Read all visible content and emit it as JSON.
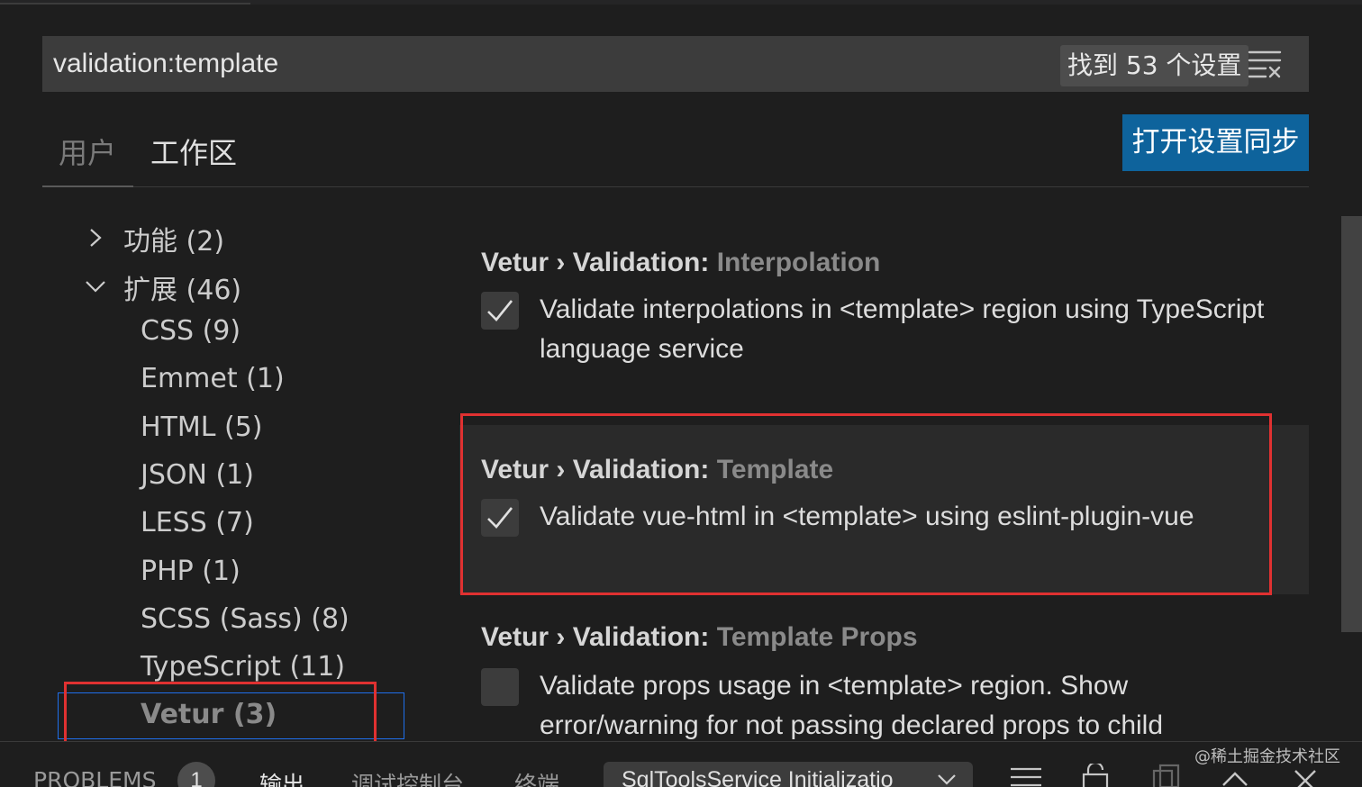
{
  "search": {
    "value": "validation:template",
    "result_count": "找到 53 个设置"
  },
  "tabs": {
    "user": "用户",
    "workspace": "工作区"
  },
  "sync_button": "打开设置同步",
  "toc": {
    "features": "功能 (2)",
    "extensions": "扩展 (46)",
    "items": [
      "CSS (9)",
      "Emmet (1)",
      "HTML (5)",
      "JSON (1)",
      "LESS (7)",
      "PHP (1)",
      "SCSS (Sass) (8)",
      "TypeScript (11)",
      "Vetur (3)"
    ]
  },
  "settings": [
    {
      "category": "Vetur › Validation: ",
      "key": "Interpolation",
      "checked": true,
      "description": "Validate interpolations in <template> region using TypeScript language service"
    },
    {
      "category": "Vetur › Validation: ",
      "key": "Template",
      "checked": true,
      "description": "Validate vue-html in <template> using eslint-plugin-vue"
    },
    {
      "category": "Vetur › Validation: ",
      "key": "Template Props",
      "checked": false,
      "description": "Validate props usage in <template> region. Show error/warning for not passing declared props to child"
    }
  ],
  "panel": {
    "problems": "PROBLEMS",
    "problems_count": "1",
    "output": "输出",
    "debug_console": "调试控制台",
    "terminal": "终端",
    "output_channel": "SqlToolsService Initializatio"
  },
  "watermark": "@稀土掘金技术社区",
  "colors": {
    "background": "#1e1e1e",
    "input": "#3c3c3c",
    "accent_button": "#0e639c",
    "highlight_border": "#e03131",
    "focus_border": "#1f6feb"
  }
}
